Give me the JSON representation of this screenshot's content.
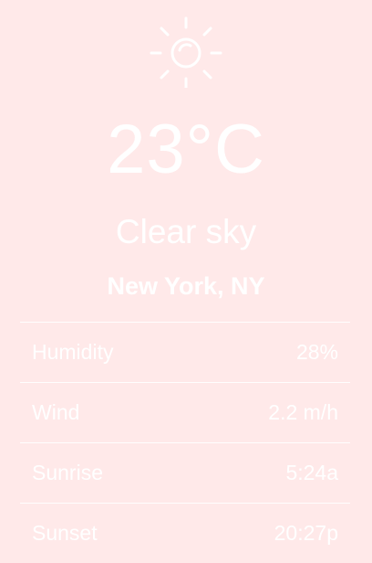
{
  "weather": {
    "icon": "sun-icon",
    "temperature": "23°C",
    "condition": "Clear sky",
    "location": "New York, NY"
  },
  "details": [
    {
      "label": "Humidity",
      "value": "28%"
    },
    {
      "label": "Wind",
      "value": "2.2 m/h"
    },
    {
      "label": "Sunrise",
      "value": "5:24a"
    },
    {
      "label": "Sunset",
      "value": "20:27p"
    }
  ],
  "colors": {
    "background": "#ffe9e9",
    "text": "#ffffff"
  }
}
